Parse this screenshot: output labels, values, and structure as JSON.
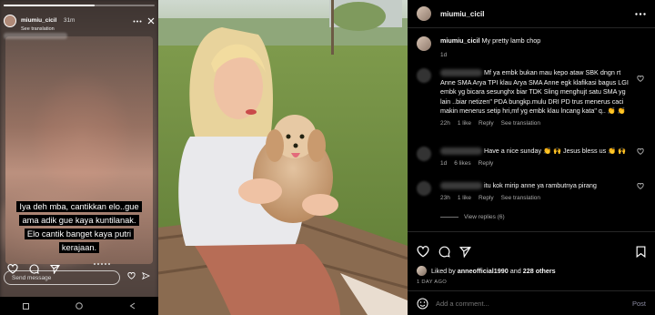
{
  "story": {
    "username": "miumiu_cicil",
    "time": "31m",
    "subtitle": "See translation",
    "caption_lines": [
      "Iya deh mba, cantikkan elo..gue",
      "ama adik gue kaya kuntilanak.",
      "Elo cantik banget kaya putri",
      "kerajaan."
    ],
    "message_placeholder": "Send message"
  },
  "post": {
    "username": "miumiu_cicil",
    "caption_user": "miumiu_cicil",
    "caption_text": "My pretty lamb chop",
    "caption_age": "1d",
    "comments": [
      {
        "text": "Mf ya embk bukan mau kepo ataw SBK dngn rt Anne SMA Arya TPI klau Arya SMA Anne egk klafikasi bagus LGI embk yg bicara sesunghx biar TDK Sling menghujt satu SMA yg lain ..biar netizen\" PDA bungkp.mulu DRI PD trus menerus caci makin menerus setip hri,mf yg embk klau lncang kata\" q.. 👏 👏",
        "age": "22h",
        "likes": "1 like",
        "reply": "Reply",
        "translate": "See translation"
      },
      {
        "text": "Have a nice sunday 👏 🙌 Jesus bless us 👏 🙌",
        "age": "1d",
        "likes": "6 likes",
        "reply": "Reply",
        "translate": ""
      },
      {
        "text": "itu kok mirip anne ya rambutnya pirang",
        "age": "23h",
        "likes": "1 like",
        "reply": "Reply",
        "translate": "See translation"
      }
    ],
    "view_replies": "View replies (6)",
    "liked_prefix": "Liked by",
    "liked_user": "anneofficial1990",
    "liked_and": "and",
    "liked_others": "228 others",
    "date": "1 DAY AGO",
    "add_comment_placeholder": "Add a comment...",
    "post_label": "Post"
  }
}
